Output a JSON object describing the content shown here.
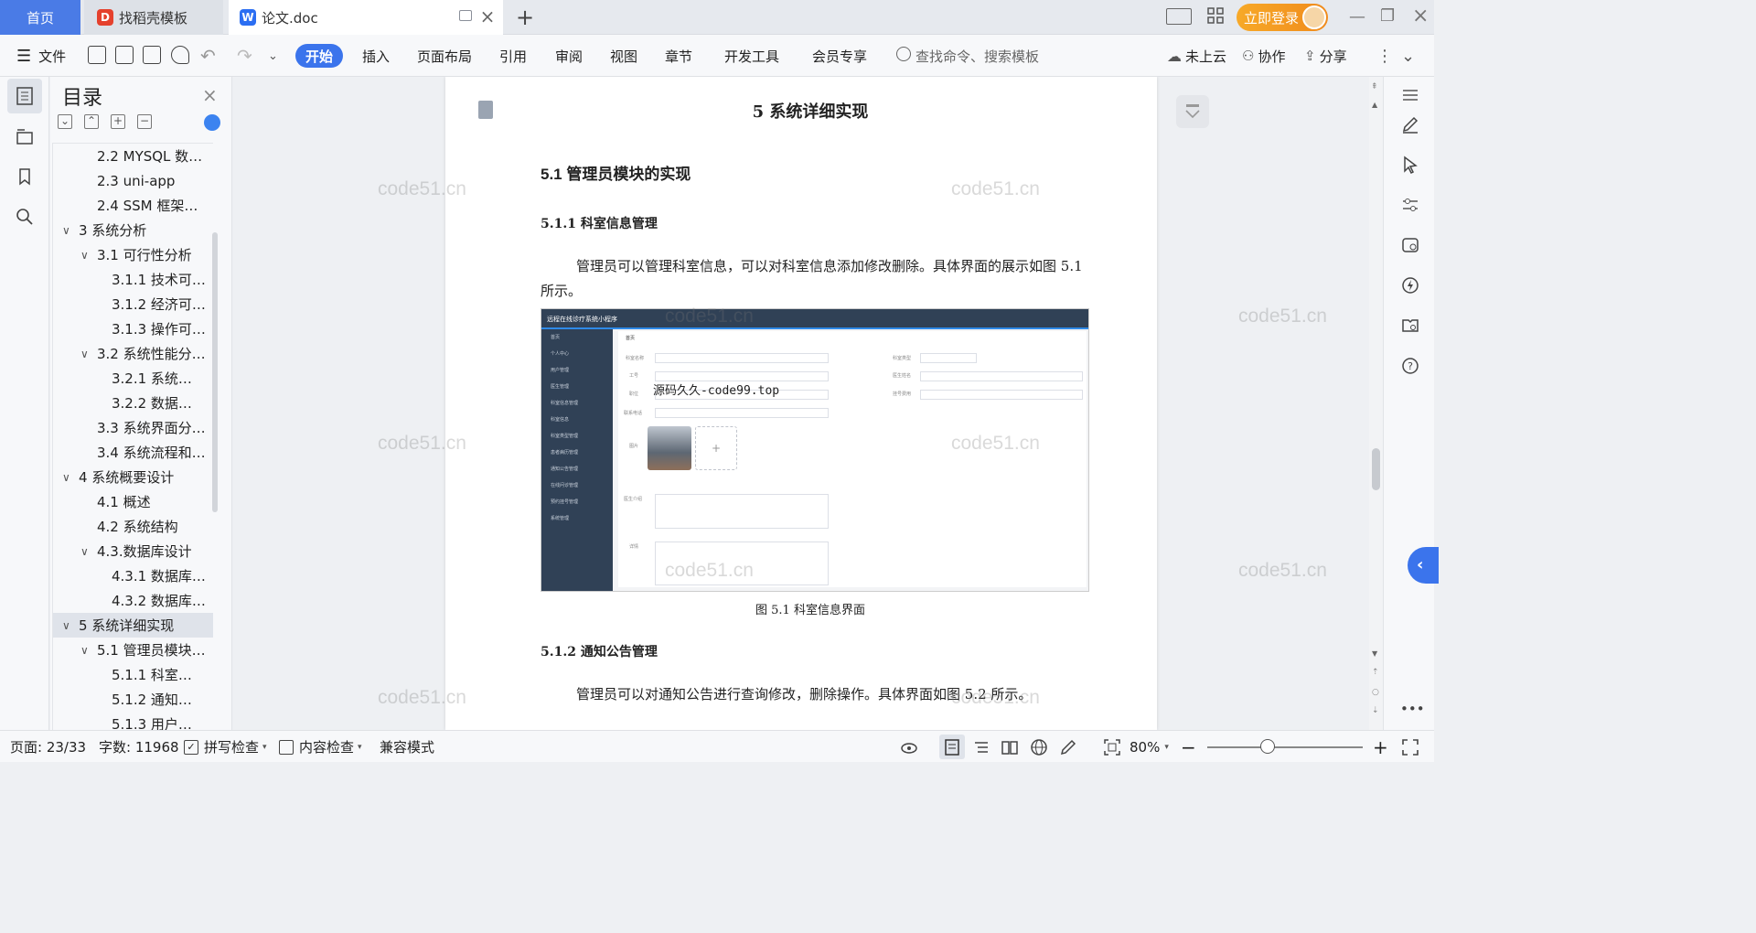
{
  "titlebar": {
    "home_tab": "首页",
    "tabs": [
      {
        "label": "找稻壳模板"
      },
      {
        "label": "论文.doc"
      }
    ],
    "login_label": "立即登录"
  },
  "ribbon": {
    "file_label": "文件",
    "tabs": [
      "开始",
      "插入",
      "页面布局",
      "引用",
      "审阅",
      "视图",
      "章节",
      "开发工具",
      "会员专享"
    ],
    "search_placeholder": "查找命令、搜索模板",
    "cloud_label": "未上云",
    "collab_label": "协作",
    "share_label": "分享"
  },
  "toc": {
    "title": "目录",
    "items": [
      {
        "label": "2.2 MYSQL 数…",
        "level": 2
      },
      {
        "label": "2.3 uni-app",
        "level": 2
      },
      {
        "label": "2.4 SSM 框架…",
        "level": 2
      },
      {
        "label": "3 系统分析",
        "level": 1,
        "expanded": true
      },
      {
        "label": "3.1 可行性分析",
        "level": 2,
        "expanded": true
      },
      {
        "label": "3.1.1 技术可…",
        "level": 3
      },
      {
        "label": "3.1.2 经济可…",
        "level": 3
      },
      {
        "label": "3.1.3 操作可…",
        "level": 3
      },
      {
        "label": "3.2 系统性能分…",
        "level": 2,
        "expanded": true
      },
      {
        "label": "3.2.1  系统…",
        "level": 3
      },
      {
        "label": "3.2.2  数据…",
        "level": 3
      },
      {
        "label": "3.3 系统界面分…",
        "level": 2
      },
      {
        "label": "3.4 系统流程和…",
        "level": 2
      },
      {
        "label": "4 系统概要设计",
        "level": 1,
        "expanded": true
      },
      {
        "label": "4.1 概述",
        "level": 2
      },
      {
        "label": "4.2 系统结构",
        "level": 2
      },
      {
        "label": "4.3.数据库设计",
        "level": 2,
        "expanded": true
      },
      {
        "label": "4.3.1 数据库…",
        "level": 3
      },
      {
        "label": "4.3.2 数据库…",
        "level": 3
      },
      {
        "label": "5 系统详细实现",
        "level": 1,
        "expanded": true,
        "selected": true
      },
      {
        "label": "5.1  管理员模块…",
        "level": 2,
        "expanded": true
      },
      {
        "label": "5.1.1  科室…",
        "level": 3
      },
      {
        "label": "5.1.2  通知…",
        "level": 3
      },
      {
        "label": "5.1.3  用户…",
        "level": 3
      }
    ]
  },
  "document": {
    "chapter_title": "5 系统详细实现",
    "section_title": "5.1  管理员模块的实现",
    "sub1_title": "5.1.1  科室信息管理",
    "para1": "管理员可以管理科室信息，可以对科室信息添加修改删除。具体界面的展示如图 5.1 所示。",
    "figure_caption": "图 5.1  科室信息界面",
    "sub2_title": "5.1.2  通知公告管理",
    "para2": "管理员可以对通知公告进行查询修改，删除操作。具体界面如图 5.2 所示。",
    "embedded": {
      "app_title": "远程在线诊疗系统小程序",
      "overlay_text": "源码久久-code99.top",
      "breadcrumb": "首页",
      "menu": [
        "首页",
        "个人中心",
        "用户管理",
        "医生管理",
        "科室信息管理",
        "科室信息",
        "科室类型管理",
        "患者病历管理",
        "通知公告管理",
        "在线问诊管理",
        "预约挂号管理",
        "系统管理"
      ],
      "form_labels": [
        "科室名称",
        "工号",
        "职位",
        "联系电话",
        "图片",
        "医生介绍",
        "详情",
        "科室类型",
        "医生姓名",
        "挂号费用"
      ]
    },
    "watermark": "code51.cn"
  },
  "statusbar": {
    "page_info": "页面: 23/33",
    "word_count": "字数: 11968",
    "spell_check": "拼写检查",
    "content_check": "内容检查",
    "compat_mode": "兼容模式",
    "zoom": "80%",
    "zoom_fraction": 0.8
  },
  "colors": {
    "accent": "#3b74ec",
    "login": "#f29a1f",
    "wps_red": "#e5412d",
    "wps_blue": "#2b6ef2"
  }
}
